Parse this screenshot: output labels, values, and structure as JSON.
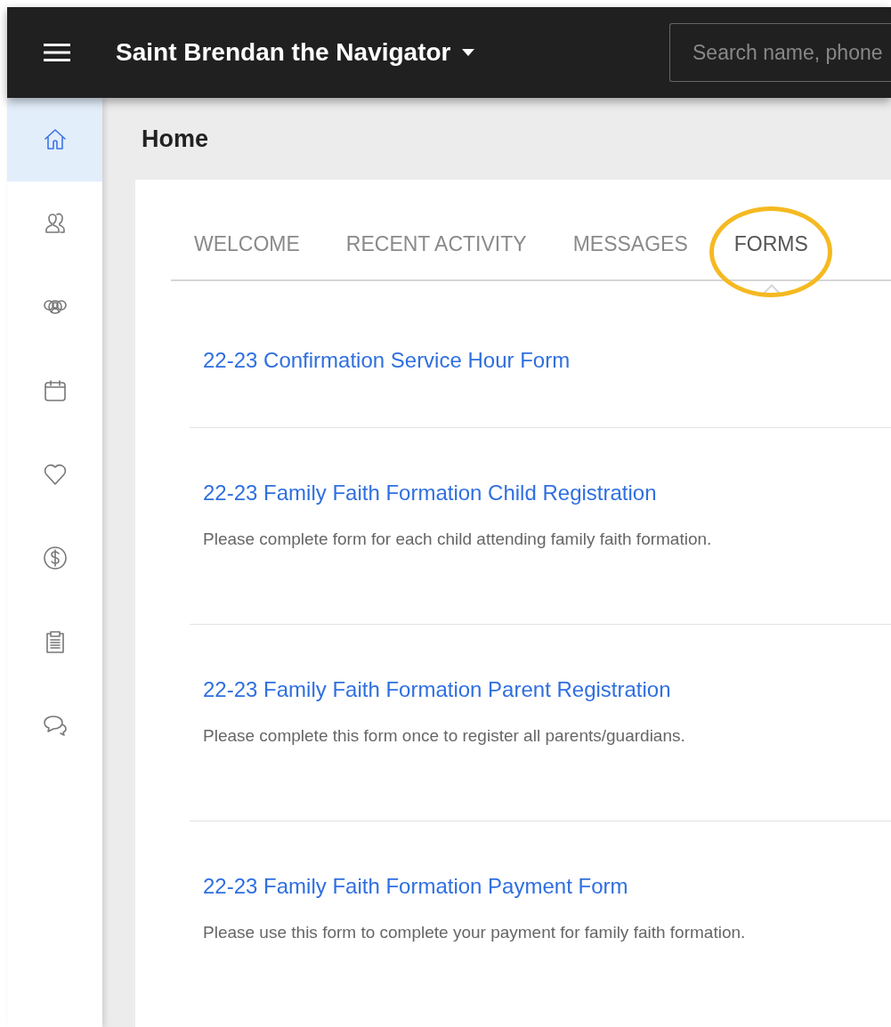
{
  "topbar": {
    "title": "Saint Brendan the Navigator",
    "search": {
      "placeholder": "Search name, phone"
    }
  },
  "sidebar": {
    "items": [
      {
        "kind": "home",
        "selected": true
      },
      {
        "kind": "people",
        "selected": false
      },
      {
        "kind": "groups",
        "selected": false
      },
      {
        "kind": "calendar",
        "selected": false
      },
      {
        "kind": "heart",
        "selected": false
      },
      {
        "kind": "dollar",
        "selected": false
      },
      {
        "kind": "clipboard",
        "selected": false
      },
      {
        "kind": "chat",
        "selected": false
      }
    ]
  },
  "page": {
    "title": "Home"
  },
  "tabs": [
    {
      "label": "WELCOME",
      "selected": false,
      "highlighted": false
    },
    {
      "label": "RECENT ACTIVITY",
      "selected": false,
      "highlighted": false
    },
    {
      "label": "MESSAGES",
      "selected": false,
      "highlighted": false
    },
    {
      "label": "FORMS",
      "selected": true,
      "highlighted": true
    }
  ],
  "forms": [
    {
      "title": "22-23 Confirmation Service Hour Form"
    },
    {
      "title": "22-23 Family Faith Formation Child Registration",
      "description": "Please complete form for each child attending family faith formation."
    },
    {
      "title": "22-23 Family Faith Formation Parent Registration",
      "description": "Please complete this form once to register all parents/guardians."
    },
    {
      "title": "22-23 Family Faith Formation Payment Form",
      "description": "Please use this form to complete your payment for family faith formation."
    }
  ]
}
